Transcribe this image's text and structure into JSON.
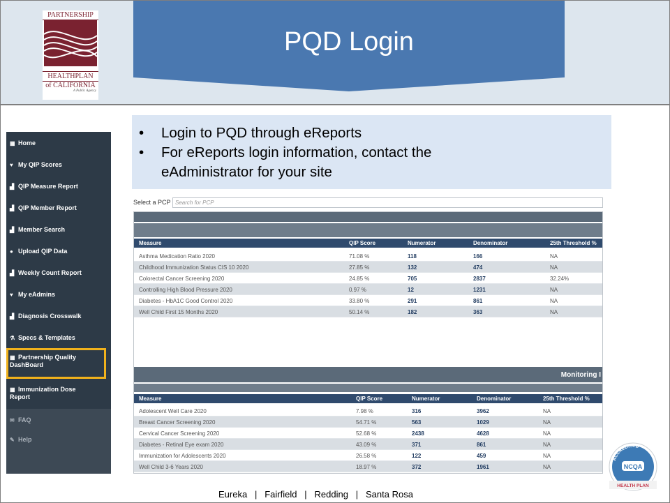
{
  "logo": {
    "line1": "PARTNERSHIP",
    "line2": "HEALTHPLAN",
    "line3": "of CALIFORNIA",
    "tagline": "A Public Agency"
  },
  "title": "PQD Login",
  "bullets": [
    {
      "text": "Login to PQD through eReports"
    },
    {
      "text": "For eReports login information, contact the"
    },
    {
      "text": "eAdministrator for your site"
    }
  ],
  "sidebar": {
    "items": [
      {
        "label": "Home",
        "icon": "grid-icon"
      },
      {
        "label": "My QIP Scores",
        "icon": "heart-icon"
      },
      {
        "label": "QIP Measure Report",
        "icon": "bar-chart-icon"
      },
      {
        "label": "QIP Member Report",
        "icon": "bar-chart-icon"
      },
      {
        "label": "Member Search",
        "icon": "bar-chart-icon"
      },
      {
        "label": "Upload QIP Data",
        "icon": "upload-icon"
      },
      {
        "label": "Weekly Count Report",
        "icon": "bar-chart-icon"
      },
      {
        "label": "My eAdmins",
        "icon": "heart-icon"
      },
      {
        "label": "Diagnosis Crosswalk",
        "icon": "bar-chart-icon"
      },
      {
        "label": "Specs & Templates",
        "icon": "flask-icon"
      },
      {
        "label1": "Partnership Quality",
        "label2": "DashBoard",
        "icon": "grid-icon"
      },
      {
        "label1": "Immunization Dose",
        "label2": "Report",
        "icon": "grid-icon"
      },
      {
        "label": "FAQ",
        "icon": "mail-icon"
      },
      {
        "label": "Help",
        "icon": "edit-icon"
      }
    ]
  },
  "pcp": {
    "label": "Select a PCP",
    "placeholder": "Search for PCP"
  },
  "columns": [
    "Measure",
    "QIP Score",
    "Numerator",
    "Denominator",
    "25th Threshold %"
  ],
  "table1": [
    {
      "measure": "Asthma Medication Ratio 2020",
      "score": "71.08 %",
      "num": "118",
      "den": "166",
      "thr": "NA"
    },
    {
      "measure": "Childhood Immunization Status CIS 10 2020",
      "score": "27.85 %",
      "num": "132",
      "den": "474",
      "thr": "NA"
    },
    {
      "measure": "Colorectal Cancer Screening 2020",
      "score": "24.85 %",
      "num": "705",
      "den": "2837",
      "thr": "32.24%"
    },
    {
      "measure": "Controlling High Blood Pressure 2020",
      "score": "0.97 %",
      "num": "12",
      "den": "1231",
      "thr": "NA"
    },
    {
      "measure": "Diabetes - HbA1C Good Control 2020",
      "score": "33.80 %",
      "num": "291",
      "den": "861",
      "thr": "NA"
    },
    {
      "measure": "Well Child First 15 Months 2020",
      "score": "50.14 %",
      "num": "182",
      "den": "363",
      "thr": "NA"
    }
  ],
  "monitoring_label": "Monitoring I",
  "table2": [
    {
      "measure": "Adolescent Well Care 2020",
      "score": "7.98 %",
      "num": "316",
      "den": "3962",
      "thr": "NA"
    },
    {
      "measure": "Breast Cancer Screening 2020",
      "score": "54.71 %",
      "num": "563",
      "den": "1029",
      "thr": "NA"
    },
    {
      "measure": "Cervical Cancer Screening 2020",
      "score": "52.68 %",
      "num": "2438",
      "den": "4628",
      "thr": "NA"
    },
    {
      "measure": "Diabetes - Retinal Eye exam 2020",
      "score": "43.09 %",
      "num": "371",
      "den": "861",
      "thr": "NA"
    },
    {
      "measure": "Immunization for Adolescents 2020",
      "score": "26.58 %",
      "num": "122",
      "den": "459",
      "thr": "NA"
    },
    {
      "measure": "Well Child 3-6 Years 2020",
      "score": "18.97 %",
      "num": "372",
      "den": "1961",
      "thr": "NA"
    }
  ],
  "footer": "Eureka   |   Fairfield   |   Redding   |   Santa Rosa",
  "badge": {
    "top": "ACCREDITED",
    "center": "NCQA",
    "bottom": "HEALTH PLAN"
  },
  "colors": {
    "banner": "#4a78b0",
    "sidebar": "#2d3a47",
    "highlight": "#f1b21c",
    "table_header": "#2f4a6d",
    "callout": "#dbe6f4"
  }
}
